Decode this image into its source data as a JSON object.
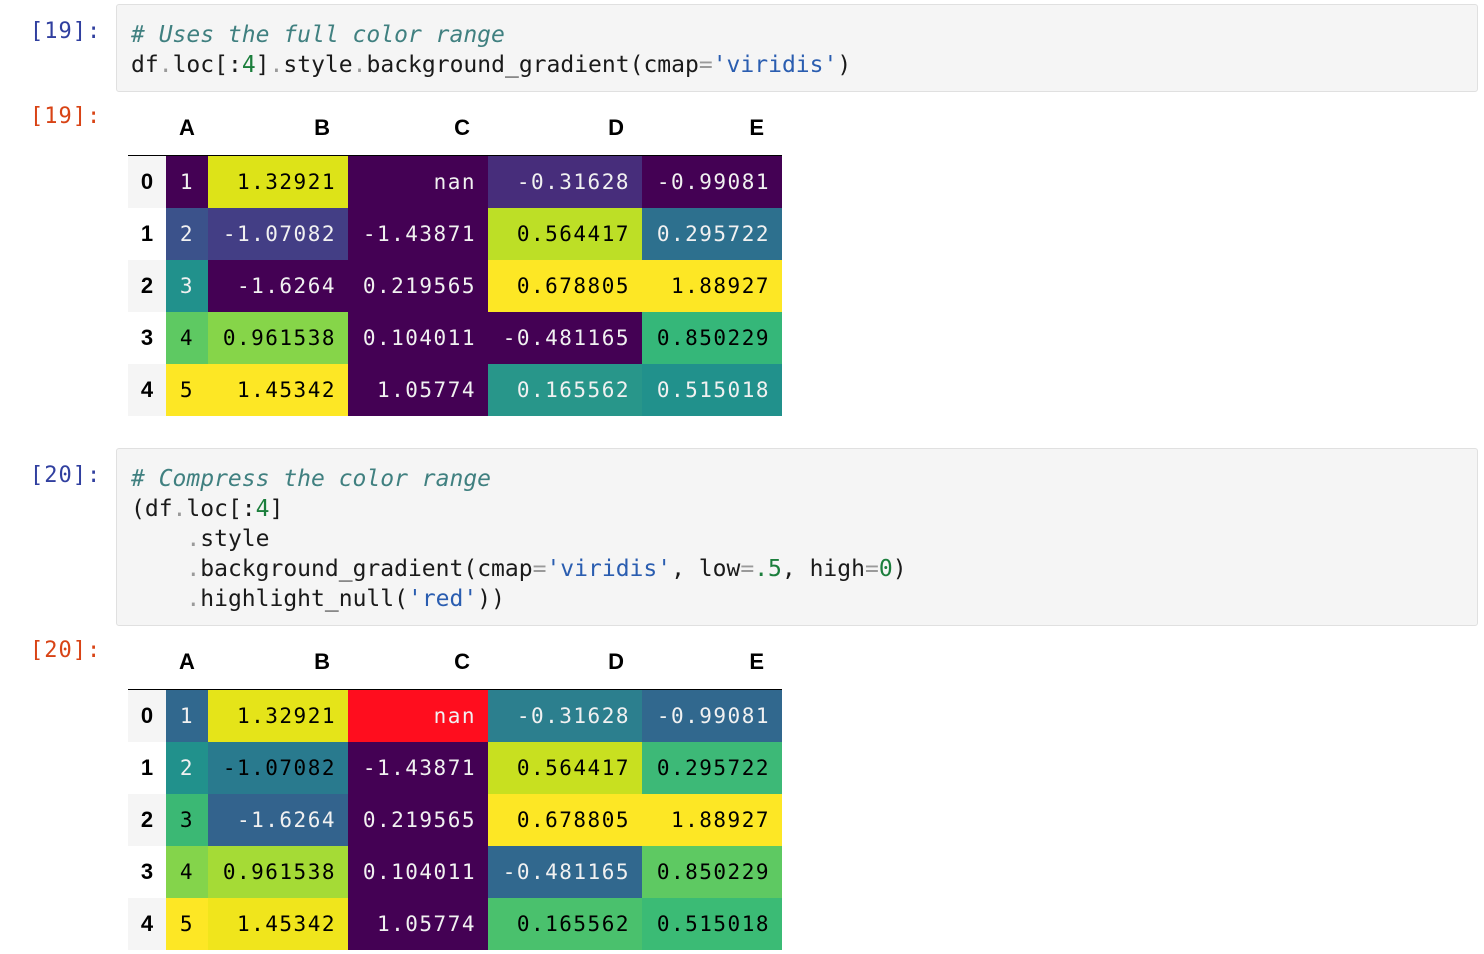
{
  "cell1": {
    "in_prompt": "[19]:",
    "out_prompt": "[19]:",
    "code_lines": [
      [
        {
          "t": "# Uses the full color range",
          "c": "comment"
        }
      ],
      [
        {
          "t": "df",
          "c": ""
        },
        {
          "t": ".",
          "c": "op"
        },
        {
          "t": "loc[:",
          "c": ""
        },
        {
          "t": "4",
          "c": "num"
        },
        {
          "t": "]",
          "c": ""
        },
        {
          "t": ".",
          "c": "op"
        },
        {
          "t": "style",
          "c": ""
        },
        {
          "t": ".",
          "c": "op"
        },
        {
          "t": "background_gradient(cmap",
          "c": ""
        },
        {
          "t": "=",
          "c": "op"
        },
        {
          "t": "'viridis'",
          "c": "str"
        },
        {
          "t": ")",
          "c": ""
        }
      ]
    ],
    "table": {
      "columns": [
        "A",
        "B",
        "C",
        "D",
        "E"
      ],
      "rows": [
        {
          "index": "0",
          "cells": [
            {
              "v": "1",
              "bg": "#440154",
              "fg": "#f1f1f1"
            },
            {
              "v": "1.32921",
              "bg": "#dde318",
              "fg": "#000000"
            },
            {
              "v": "nan",
              "bg": "#440154",
              "fg": "#f1f1f1"
            },
            {
              "v": "-0.31628",
              "bg": "#472d7b",
              "fg": "#f1f1f1"
            },
            {
              "v": "-0.99081",
              "bg": "#440154",
              "fg": "#f1f1f1"
            }
          ]
        },
        {
          "index": "1",
          "cells": [
            {
              "v": "2",
              "bg": "#3b528b",
              "fg": "#f1f1f1"
            },
            {
              "v": "-1.07082",
              "bg": "#433e85",
              "fg": "#f1f1f1"
            },
            {
              "v": "-1.43871",
              "bg": "#440154",
              "fg": "#f1f1f1"
            },
            {
              "v": "0.564417",
              "bg": "#bddf26",
              "fg": "#000000"
            },
            {
              "v": "0.295722",
              "bg": "#2d708e",
              "fg": "#f1f1f1"
            }
          ]
        },
        {
          "index": "2",
          "cells": [
            {
              "v": "3",
              "bg": "#21918c",
              "fg": "#f1f1f1"
            },
            {
              "v": "-1.6264",
              "bg": "#440154",
              "fg": "#f1f1f1"
            },
            {
              "v": "0.219565",
              "bg": "#440154",
              "fg": "#f1f1f1"
            },
            {
              "v": "0.678805",
              "bg": "#fde725",
              "fg": "#000000"
            },
            {
              "v": "1.88927",
              "bg": "#fde725",
              "fg": "#000000"
            }
          ]
        },
        {
          "index": "3",
          "cells": [
            {
              "v": "4",
              "bg": "#5ec962",
              "fg": "#000000"
            },
            {
              "v": "0.961538",
              "bg": "#86d549",
              "fg": "#000000"
            },
            {
              "v": "0.104011",
              "bg": "#440154",
              "fg": "#f1f1f1"
            },
            {
              "v": "-0.481165",
              "bg": "#440154",
              "fg": "#f1f1f1"
            },
            {
              "v": "0.850229",
              "bg": "#35b779",
              "fg": "#000000"
            }
          ]
        },
        {
          "index": "4",
          "cells": [
            {
              "v": "5",
              "bg": "#fde725",
              "fg": "#000000"
            },
            {
              "v": "1.45342",
              "bg": "#fde725",
              "fg": "#000000"
            },
            {
              "v": "1.05774",
              "bg": "#440154",
              "fg": "#f1f1f1"
            },
            {
              "v": "0.165562",
              "bg": "#28968a",
              "fg": "#f1f1f1"
            },
            {
              "v": "0.515018",
              "bg": "#21918c",
              "fg": "#f1f1f1"
            }
          ]
        }
      ]
    }
  },
  "cell2": {
    "in_prompt": "[20]:",
    "out_prompt": "[20]:",
    "code_lines": [
      [
        {
          "t": "# Compress the color range",
          "c": "comment"
        }
      ],
      [
        {
          "t": "(df",
          "c": ""
        },
        {
          "t": ".",
          "c": "op"
        },
        {
          "t": "loc[:",
          "c": ""
        },
        {
          "t": "4",
          "c": "num"
        },
        {
          "t": "]",
          "c": ""
        }
      ],
      [
        {
          "t": "    ",
          "c": ""
        },
        {
          "t": ".",
          "c": "op"
        },
        {
          "t": "style",
          "c": ""
        }
      ],
      [
        {
          "t": "    ",
          "c": ""
        },
        {
          "t": ".",
          "c": "op"
        },
        {
          "t": "background_gradient(cmap",
          "c": ""
        },
        {
          "t": "=",
          "c": "op"
        },
        {
          "t": "'viridis'",
          "c": "str"
        },
        {
          "t": ", low",
          "c": ""
        },
        {
          "t": "=",
          "c": "op"
        },
        {
          "t": ".5",
          "c": "num"
        },
        {
          "t": ", high",
          "c": ""
        },
        {
          "t": "=",
          "c": "op"
        },
        {
          "t": "0",
          "c": "num"
        },
        {
          "t": ")",
          "c": ""
        }
      ],
      [
        {
          "t": "    ",
          "c": ""
        },
        {
          "t": ".",
          "c": "op"
        },
        {
          "t": "highlight_null(",
          "c": ""
        },
        {
          "t": "'red'",
          "c": "str"
        },
        {
          "t": "))",
          "c": ""
        }
      ]
    ],
    "table": {
      "columns": [
        "A",
        "B",
        "C",
        "D",
        "E"
      ],
      "rows": [
        {
          "index": "0",
          "cells": [
            {
              "v": "1",
              "bg": "#31688e",
              "fg": "#f1f1f1"
            },
            {
              "v": "1.32921",
              "bg": "#e5e419",
              "fg": "#000000"
            },
            {
              "v": "nan",
              "bg": "#ff0d1e",
              "fg": "#f1f1f1"
            },
            {
              "v": "-0.31628",
              "bg": "#2c7f8e",
              "fg": "#f1f1f1"
            },
            {
              "v": "-0.99081",
              "bg": "#31688e",
              "fg": "#f1f1f1"
            }
          ]
        },
        {
          "index": "1",
          "cells": [
            {
              "v": "2",
              "bg": "#21918c",
              "fg": "#f1f1f1"
            },
            {
              "v": "-1.07082",
              "bg": "#297a8e",
              "fg": "#000000"
            },
            {
              "v": "-1.43871",
              "bg": "#440154",
              "fg": "#f1f1f1"
            },
            {
              "v": "0.564417",
              "bg": "#c8e020",
              "fg": "#000000"
            },
            {
              "v": "0.295722",
              "bg": "#3db977",
              "fg": "#000000"
            }
          ]
        },
        {
          "index": "2",
          "cells": [
            {
              "v": "3",
              "bg": "#3bb874",
              "fg": "#000000"
            },
            {
              "v": "-1.6264",
              "bg": "#33638d",
              "fg": "#f1f1f1"
            },
            {
              "v": "0.219565",
              "bg": "#440154",
              "fg": "#f1f1f1"
            },
            {
              "v": "0.678805",
              "bg": "#fde725",
              "fg": "#000000"
            },
            {
              "v": "1.88927",
              "bg": "#fde725",
              "fg": "#000000"
            }
          ]
        },
        {
          "index": "3",
          "cells": [
            {
              "v": "4",
              "bg": "#84d44b",
              "fg": "#000000"
            },
            {
              "v": "0.961538",
              "bg": "#a5db36",
              "fg": "#000000"
            },
            {
              "v": "0.104011",
              "bg": "#440154",
              "fg": "#f1f1f1"
            },
            {
              "v": "-0.481165",
              "bg": "#31688e",
              "fg": "#f1f1f1"
            },
            {
              "v": "0.850229",
              "bg": "#5ec962",
              "fg": "#000000"
            }
          ]
        },
        {
          "index": "4",
          "cells": [
            {
              "v": "5",
              "bg": "#fde725",
              "fg": "#000000"
            },
            {
              "v": "1.45342",
              "bg": "#f0e51c",
              "fg": "#000000"
            },
            {
              "v": "1.05774",
              "bg": "#440154",
              "fg": "#f1f1f1"
            },
            {
              "v": "0.165562",
              "bg": "#4ac16d",
              "fg": "#000000"
            },
            {
              "v": "0.515018",
              "bg": "#3bbb75",
              "fg": "#000000"
            }
          ]
        }
      ]
    }
  }
}
